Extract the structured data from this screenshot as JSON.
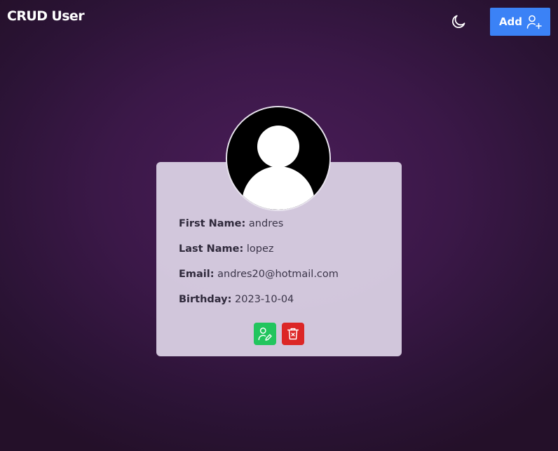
{
  "header": {
    "title": "CRUD User",
    "theme_toggle_icon": "moon-icon",
    "add_button": {
      "label": "Add",
      "icon": "user-plus-icon",
      "color": "#3b82f6"
    }
  },
  "user_card": {
    "avatar_icon": "user-avatar-icon",
    "fields": [
      {
        "label": "First Name:",
        "value": "andres"
      },
      {
        "label": "Last Name:",
        "value": "lopez"
      },
      {
        "label": "Email:",
        "value": "andres20@hotmail.com"
      },
      {
        "label": "Birthday:",
        "value": "2023-10-04"
      }
    ],
    "actions": {
      "edit": {
        "icon": "user-edit-icon",
        "color": "#22c55e"
      },
      "delete": {
        "icon": "trash-icon",
        "color": "#dc2626"
      }
    }
  },
  "colors": {
    "background": "#3b1848",
    "card": "#dcd4e4"
  }
}
